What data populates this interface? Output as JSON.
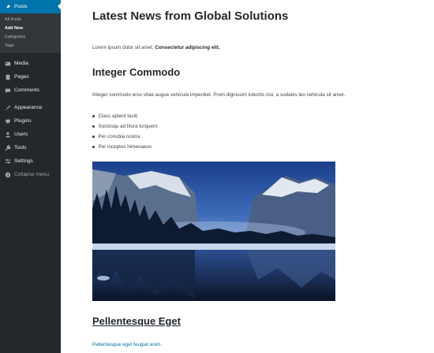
{
  "sidebar": {
    "posts": "Posts",
    "submenu": [
      "All Posts",
      "Add New",
      "Categories",
      "Tags"
    ],
    "media": "Media",
    "pages": "Pages",
    "comments": "Comments",
    "appearance": "Appearance",
    "plugins": "Plugins",
    "users": "Users",
    "tools": "Tools",
    "settings": "Settings",
    "collapse": "Collapse menu"
  },
  "post": {
    "title": "Latest News from Global Solutions",
    "intro_plain": "Lorem ipsum dolor sit amet. ",
    "intro_bold": "Consectetur adipiscing elit.",
    "heading1": "Integer Commodo",
    "para2_a": "Integer commodo eros vitae augue ",
    "para2_em": "vehicula",
    "para2_b": " imperdiet. Proin dignissim lobortis nisi, a sodales leo vehicula sit amet.",
    "list": [
      "Class aptent taciti",
      "Sociosqu ad litora torquent",
      "Per conubia nostra",
      "Per inceptos himenaeos"
    ],
    "heading2": "Pellentesque Eget",
    "link_text": "Pellentesque eget feugiat enim."
  },
  "colors": {
    "sidebar_bg": "#23282d",
    "accent": "#0073aa"
  }
}
